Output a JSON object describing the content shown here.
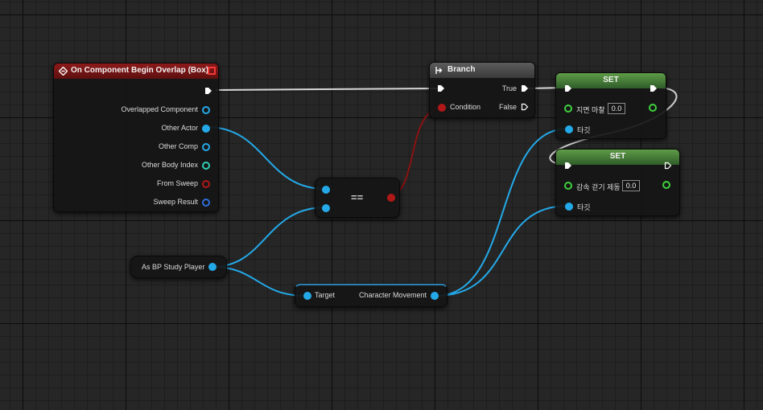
{
  "event_node": {
    "title": "On Component Begin Overlap (Box)",
    "header_color": "#7a1414",
    "pins": [
      "Overlapped Component",
      "Other Actor",
      "Other Comp",
      "Other Body Index",
      "From Sweep",
      "Sweep Result"
    ]
  },
  "branch_node": {
    "title": "Branch",
    "condition_label": "Condition",
    "true_label": "True",
    "false_label": "False"
  },
  "equal_node": {
    "operator": "=="
  },
  "player_node": {
    "label": "As BP Study Player"
  },
  "movement_node": {
    "target_label": "Target",
    "output_label": "Character Movement"
  },
  "set_node_1": {
    "title": "SET",
    "field_label": "지면 마찰",
    "field_value": "0.0",
    "target_label": "타깃"
  },
  "set_node_2": {
    "title": "SET",
    "field_label": "감속 걷기 제동",
    "field_value": "0.0",
    "target_label": "타깃"
  },
  "colors": {
    "object_pin": "#24a9e8",
    "float_pin": "#3fd13f",
    "bool_pin": "#b01818",
    "int_pin": "#2fcfb3",
    "struct_pin": "#2e6fdc",
    "exec_wire": "#d8d8d8",
    "set_header": "#4f8f3e"
  }
}
